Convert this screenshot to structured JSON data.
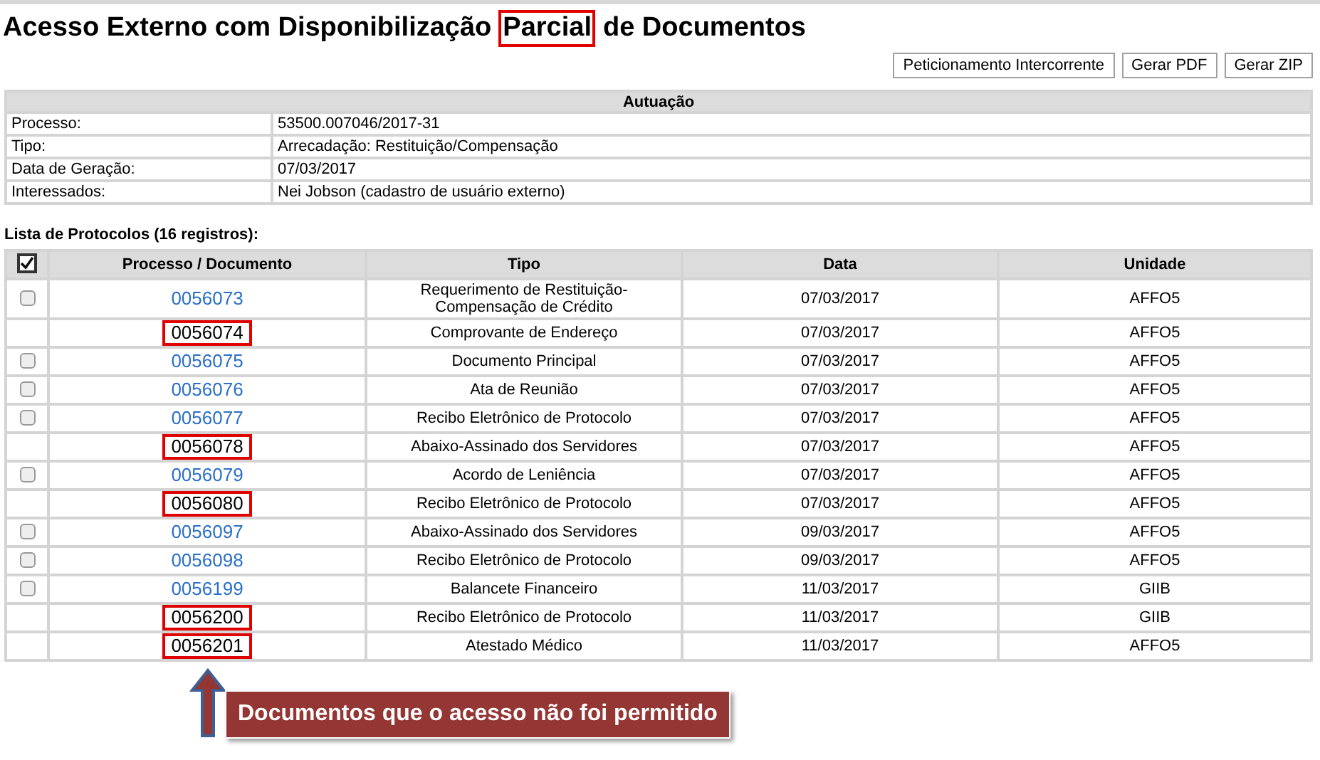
{
  "title": {
    "before": "Acesso Externo com Disponibilização",
    "highlight": "Parcial",
    "after": "de Documentos"
  },
  "buttons": [
    "Peticionamento Intercorrente",
    "Gerar PDF",
    "Gerar ZIP"
  ],
  "autuacao": {
    "heading": "Autuação",
    "rows": [
      {
        "label": "Processo:",
        "value": "53500.007046/2017-31"
      },
      {
        "label": "Tipo:",
        "value": "Arrecadação: Restituição/Compensação"
      },
      {
        "label": "Data de Geração:",
        "value": "07/03/2017"
      },
      {
        "label": "Interessados:",
        "value": "Nei Jobson (cadastro de usuário externo)"
      }
    ]
  },
  "list_caption": "Lista de Protocolos (16 registros):",
  "table": {
    "select_all_checked": true,
    "columns": [
      "Processo / Documento",
      "Tipo",
      "Data",
      "Unidade"
    ],
    "rows": [
      {
        "documento": "0056073",
        "tipo": "Requerimento de Restituição-Compensação de Crédito",
        "data": "07/03/2017",
        "unidade": "AFFO5",
        "accessible": true,
        "checked": false
      },
      {
        "documento": "0056074",
        "tipo": "Comprovante de Endereço",
        "data": "07/03/2017",
        "unidade": "AFFO5",
        "accessible": false
      },
      {
        "documento": "0056075",
        "tipo": "Documento Principal",
        "data": "07/03/2017",
        "unidade": "AFFO5",
        "accessible": true,
        "checked": false
      },
      {
        "documento": "0056076",
        "tipo": "Ata de Reunião",
        "data": "07/03/2017",
        "unidade": "AFFO5",
        "accessible": true,
        "checked": false
      },
      {
        "documento": "0056077",
        "tipo": "Recibo Eletrônico de Protocolo",
        "data": "07/03/2017",
        "unidade": "AFFO5",
        "accessible": true,
        "checked": false
      },
      {
        "documento": "0056078",
        "tipo": "Abaixo-Assinado dos Servidores",
        "data": "07/03/2017",
        "unidade": "AFFO5",
        "accessible": false
      },
      {
        "documento": "0056079",
        "tipo": "Acordo de Leniência",
        "data": "07/03/2017",
        "unidade": "AFFO5",
        "accessible": true,
        "checked": false
      },
      {
        "documento": "0056080",
        "tipo": "Recibo Eletrônico de Protocolo",
        "data": "07/03/2017",
        "unidade": "AFFO5",
        "accessible": false
      },
      {
        "documento": "0056097",
        "tipo": "Abaixo-Assinado dos Servidores",
        "data": "09/03/2017",
        "unidade": "AFFO5",
        "accessible": true,
        "checked": false
      },
      {
        "documento": "0056098",
        "tipo": "Recibo Eletrônico de Protocolo",
        "data": "09/03/2017",
        "unidade": "AFFO5",
        "accessible": true,
        "checked": false
      },
      {
        "documento": "0056199",
        "tipo": "Balancete Financeiro",
        "data": "11/03/2017",
        "unidade": "GIIB",
        "accessible": true,
        "checked": false
      },
      {
        "documento": "0056200",
        "tipo": "Recibo Eletrônico de Protocolo",
        "data": "11/03/2017",
        "unidade": "GIIB",
        "accessible": false
      },
      {
        "documento": "0056201",
        "tipo": "Atestado Médico",
        "data": "11/03/2017",
        "unidade": "AFFO5",
        "accessible": false
      }
    ]
  },
  "callout": "Documentos que o acesso não foi permitido"
}
